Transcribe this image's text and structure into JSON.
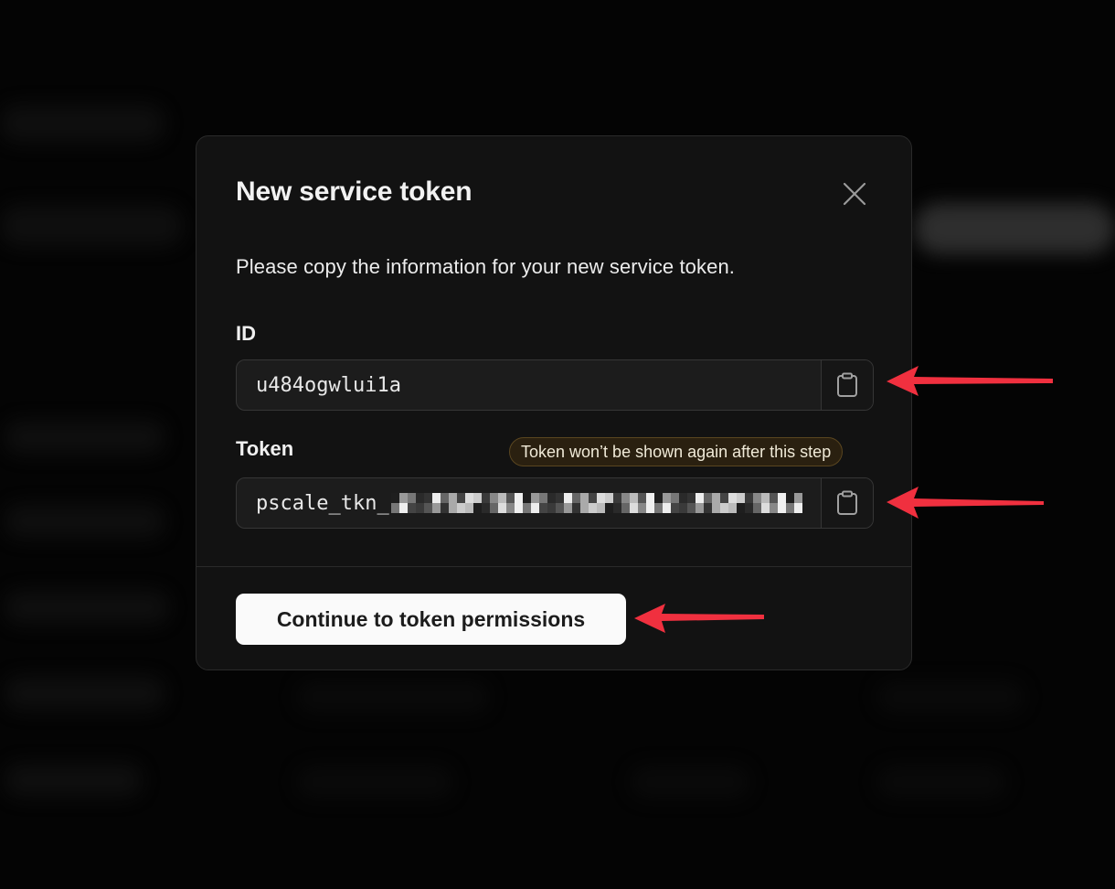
{
  "modal": {
    "title": "New service token",
    "description": "Please copy the information for your new service token.",
    "close_icon": "close-icon",
    "id_field": {
      "label": "ID",
      "value": "u484ogwlui1a",
      "copy_icon": "clipboard-icon"
    },
    "token_field": {
      "label": "Token",
      "value_prefix": "pscale_tkn_",
      "value_redacted": true,
      "warning": "Token won’t be shown again after this step",
      "copy_icon": "clipboard-icon"
    },
    "continue_button": "Continue to token permissions"
  },
  "annotations": {
    "arrow_color": "#f0303f",
    "arrows": [
      "points-to-id-copy-button",
      "points-to-token-copy-button",
      "points-to-continue-button"
    ]
  },
  "colors": {
    "modal_bg": "#121212",
    "warning_bg": "#2a2010",
    "warning_border": "#5a4620",
    "button_bg": "#fafafa"
  }
}
